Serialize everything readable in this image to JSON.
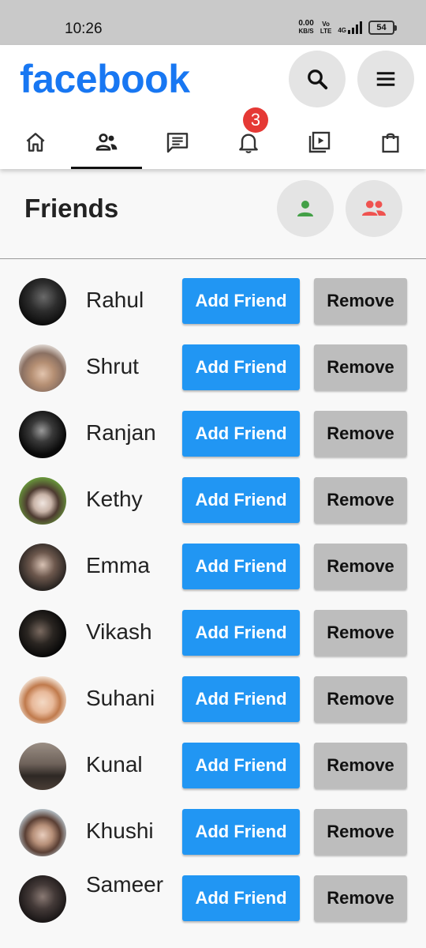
{
  "status_bar": {
    "time": "10:26",
    "net_speed_value": "0.00",
    "net_speed_unit": "KB/S",
    "volte_top": "Vo",
    "volte_bottom": "LTE",
    "network": "4G",
    "battery": "54"
  },
  "header": {
    "logo": "facebook",
    "brand_color": "#1877f2",
    "search_icon": "search-icon",
    "menu_icon": "menu-icon"
  },
  "tabs": [
    {
      "name": "home",
      "icon": "home-icon"
    },
    {
      "name": "friends",
      "icon": "friends-icon",
      "active": true
    },
    {
      "name": "messages",
      "icon": "message-icon"
    },
    {
      "name": "notifications",
      "icon": "bell-icon",
      "badge": "3"
    },
    {
      "name": "watch",
      "icon": "video-icon"
    },
    {
      "name": "marketplace",
      "icon": "shopping-bag-icon"
    }
  ],
  "friends_section": {
    "title": "Friends",
    "person_icon_color": "#43a047",
    "people_icon_color": "#ef5350"
  },
  "actions": {
    "add_label": "Add Friend",
    "remove_label": "Remove",
    "add_color": "#2196f3",
    "remove_color": "#bdbdbd"
  },
  "friends": [
    {
      "name": "Rahul"
    },
    {
      "name": "Shrut"
    },
    {
      "name": "Ranjan"
    },
    {
      "name": "Kethy"
    },
    {
      "name": "Emma"
    },
    {
      "name": "Vikash"
    },
    {
      "name": "Suhani"
    },
    {
      "name": "Kunal"
    },
    {
      "name": "Khushi"
    },
    {
      "name": "Sameer"
    }
  ]
}
